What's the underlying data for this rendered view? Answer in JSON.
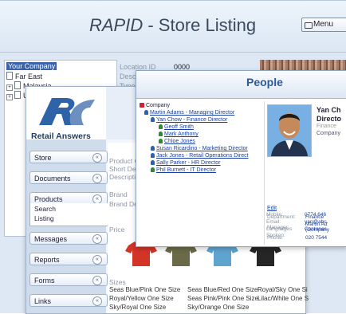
{
  "store_window": {
    "title_brand": "RAPID",
    "title_rest": " - Store Listing",
    "menu_label": "Menu",
    "tree": [
      "Your Company",
      "Far East",
      "Malaysia",
      "UK"
    ],
    "fields": [
      {
        "label": "Location ID",
        "value": "0000"
      },
      {
        "label": "Description",
        "value": ""
      },
      {
        "label": "Type",
        "value": ""
      }
    ]
  },
  "retail_window": {
    "brand": "Retail Answers",
    "sidebar": {
      "sections": [
        "Store",
        "Documents",
        "Products",
        "Messages",
        "Reports",
        "Forms",
        "Links"
      ],
      "products_items": [
        "Search",
        "Listing"
      ]
    },
    "main": {
      "labels": [
        "Product Cod",
        "Short Descri",
        "Description",
        "Brand",
        "Brand Descri",
        "Price",
        "Sizes"
      ],
      "sizes": [
        [
          "Seas Blue/Pink One Size",
          "Seas Blue/Red One Size",
          "Royal/Sky One Si"
        ],
        [
          "Royal/Yellow One Size",
          "Seas Pink/Pink One Size",
          "Lilac/White One S"
        ],
        [
          "Sky/Royal One Size",
          "Sky/Orange One Size",
          ""
        ]
      ],
      "tshirt_colors": [
        "#d23526",
        "#6b6a48",
        "#5fa3cf",
        "#262626"
      ]
    }
  },
  "people_window": {
    "title": "People",
    "org_root": "Company",
    "org": [
      {
        "text": "Martin Adams - Managing Director",
        "level": 0,
        "icon": "blue"
      },
      {
        "text": "Yan Chow - Finance Director",
        "level": 1,
        "icon": "blue"
      },
      {
        "text": "Geoff Smith",
        "level": 2,
        "icon": "green"
      },
      {
        "text": "Mark Anthony",
        "level": 2,
        "icon": "green"
      },
      {
        "text": "Chloe Jones",
        "level": 2,
        "icon": "green"
      },
      {
        "text": "Susan Ricardino - Marketing Director",
        "level": 1,
        "icon": "blue"
      },
      {
        "text": "Jack Jones - Retail Operations Direct",
        "level": 1,
        "icon": "blue"
      },
      {
        "text": "Sally Parker - HR Director",
        "level": 1,
        "icon": "blue"
      },
      {
        "text": "Phil Burnett - IT Director",
        "level": 1,
        "icon": "green"
      }
    ],
    "card": {
      "name": "Yan Ch",
      "role": "Directo",
      "dept_small": "Finance",
      "company": "Company",
      "edit_label": "Edit",
      "details": [
        {
          "label": "Department:",
          "value": "Finance"
        },
        {
          "label": "Manager:",
          "value": "Martin Ad"
        },
        {
          "label": "",
          "value": "(Company"
        },
        {
          "label": "Phone:",
          "value": "020 7544"
        },
        {
          "label": "Mobile:",
          "value": "0774 646"
        },
        {
          "label": "Email:",
          "value": "yan@abc."
        },
        {
          "label": "Languages",
          "value": "Cantones"
        },
        {
          "label": "Spoken:",
          "value": ""
        }
      ]
    }
  }
}
